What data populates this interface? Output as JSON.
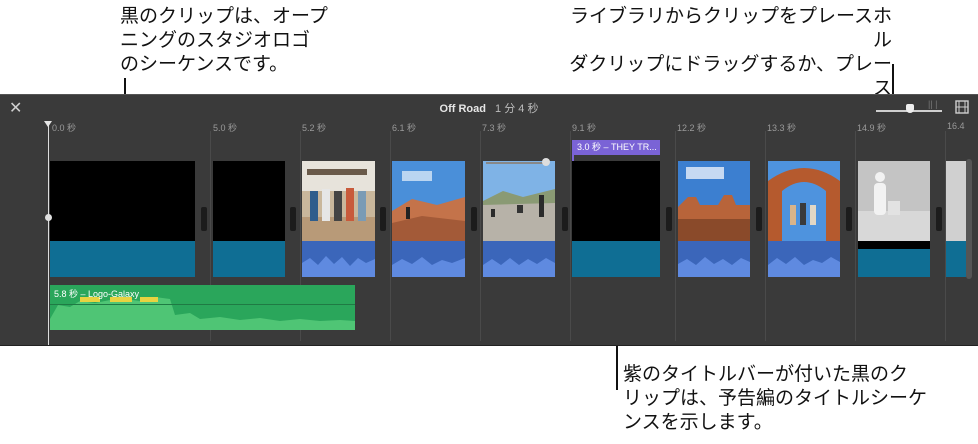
{
  "callouts": {
    "left": "黒のクリップは、オープ\nニングのスタジオロゴ\nのシーケンスです。",
    "right": "ライブラリからクリップをプレースホル\nダクリップにドラッグするか、プレース\nホルダを削除します。",
    "bottom": "紫のタイトルバーが付いた黒のク\nリップは、予告編のタイトルシーケ\nンスを示します。"
  },
  "toolbar": {
    "project_title": "Off Road",
    "duration": "1 分 4 秒",
    "close_icon": "close-icon",
    "zoom_ticks": "|| |",
    "film_icon": "film-strip-icon"
  },
  "ruler": [
    "0.0 秒",
    "5.0 秒",
    "5.2 秒",
    "6.1 秒",
    "7.3 秒",
    "9.1 秒",
    "12.2 秒",
    "13.3 秒",
    "14.9 秒",
    "16.4"
  ],
  "title_bar": "3.0 秒 – THEY TR...",
  "background_music": "5.8 秒 – Logo-Galaxy",
  "colors": {
    "editor_bg": "#3a3a3a",
    "black_audio": "#0f6e94",
    "photo_audio": "#3b66ba",
    "title_purple": "#7a63d6",
    "music_green": "#2aa65b",
    "music_highlight": "#e8d341"
  }
}
